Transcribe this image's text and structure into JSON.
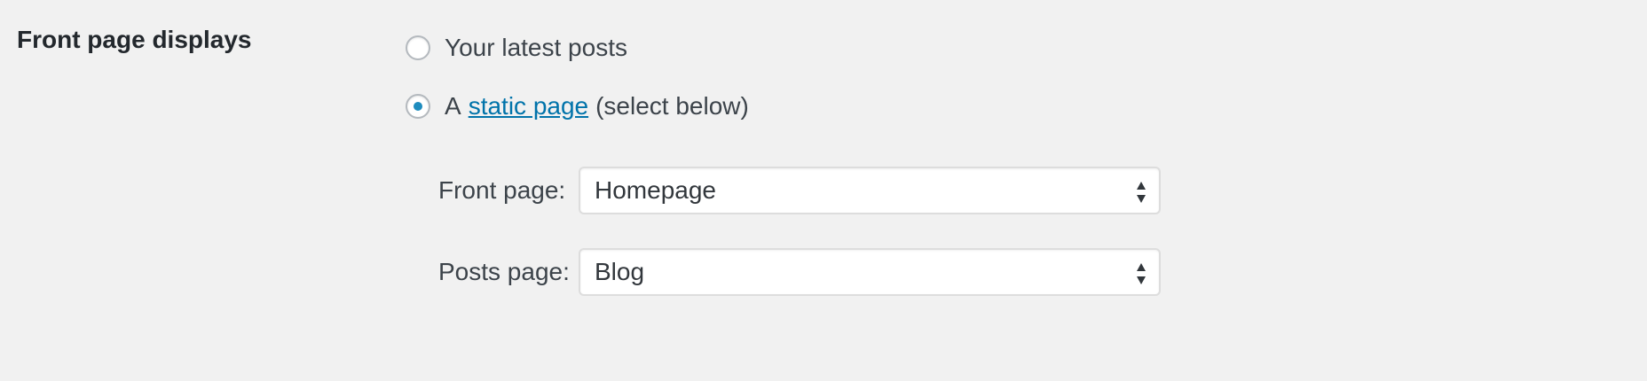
{
  "setting": {
    "heading": "Front page displays"
  },
  "options": {
    "latest_posts_label": "Your latest posts",
    "static_prefix": "A",
    "static_link": "static page",
    "static_suffix": "(select below)"
  },
  "selects": {
    "front_page_label": "Front page:",
    "front_page_value": "Homepage",
    "posts_page_label": "Posts page:",
    "posts_page_value": "Blog"
  },
  "colors": {
    "background": "#f1f1f1",
    "link": "#0073aa",
    "radio_checked": "#1e8cbe"
  },
  "icons": {
    "select_arrows": "up-down-caret-icon"
  }
}
